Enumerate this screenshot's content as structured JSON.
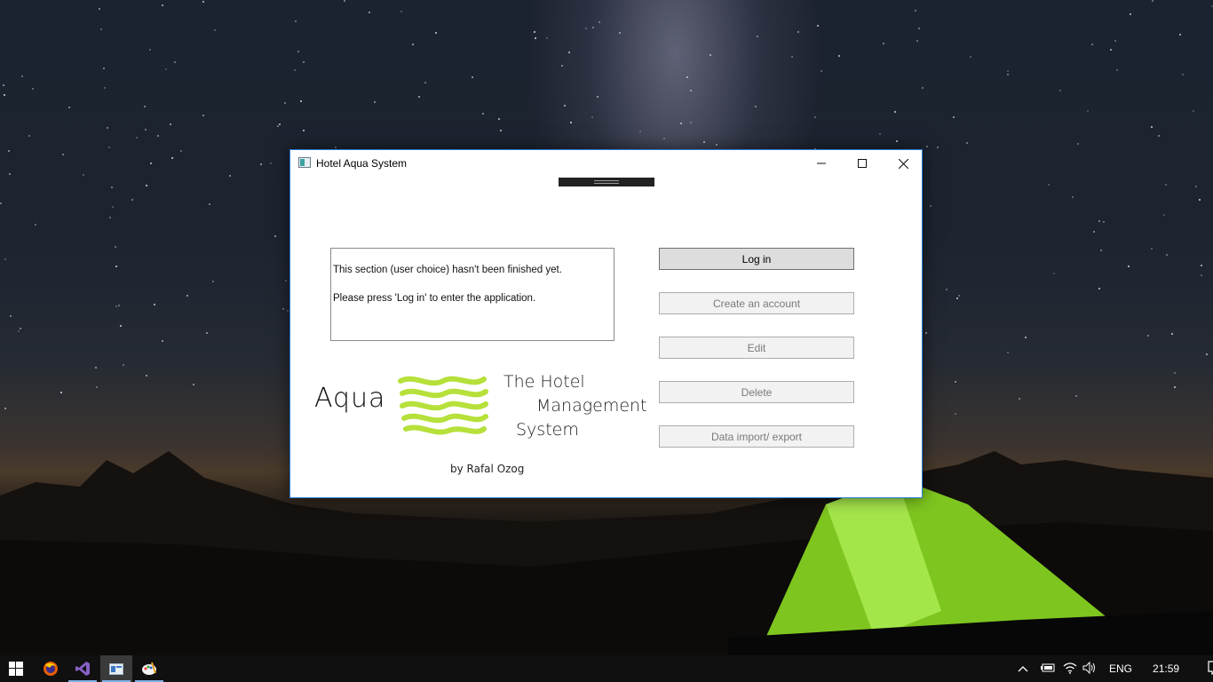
{
  "window": {
    "title": "Hotel Aqua System",
    "minimize_icon": "minimize-icon",
    "maximize_icon": "maximize-icon",
    "close_icon": "close-icon"
  },
  "info": {
    "line1": "This section (user choice) hasn't been finished yet.",
    "line2": "Please press 'Log in' to enter the application."
  },
  "actions": {
    "login": "Log in",
    "create_account": "Create an account",
    "edit": "Edit",
    "delete": "Delete",
    "data_import_export": "Data import/ export"
  },
  "logo": {
    "brand": "Aqua",
    "tagline1": "The Hotel",
    "tagline2": "Management",
    "tagline3": "System",
    "credit": "by Rafal Ozog",
    "accent_color": "#b6e03a"
  },
  "taskbar": {
    "start_icon": "windows-start-icon",
    "apps": [
      "firefox-icon",
      "visual-studio-icon",
      "hotel-app-icon",
      "paint-icon"
    ],
    "language": "ENG",
    "time": "21:59"
  },
  "colors": {
    "window_border": "#2b7bd1",
    "taskbar_bg": "#101010"
  }
}
